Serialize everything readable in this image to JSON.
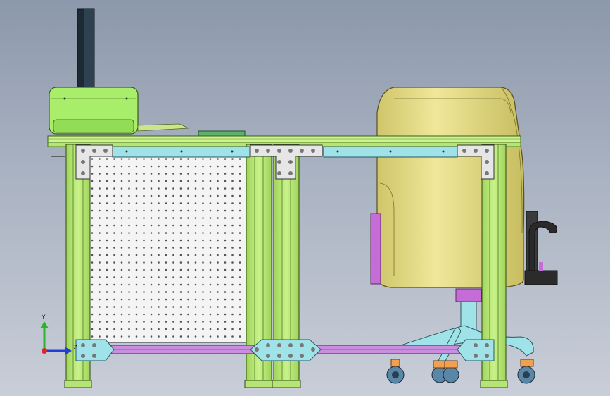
{
  "viewport": {
    "background_top": "#8c98ab",
    "background_bottom": "#c9ced8"
  },
  "model": {
    "frame_color": "#b3e86a",
    "panel_color": "#f2f2f2",
    "bracket_color": "#9fe3e8",
    "rail_color": "#c98ee0",
    "chair_color": "#e9e090",
    "outline_color": "#2a2a2a"
  },
  "triad": {
    "y_label": "Y",
    "z_label": "Z",
    "icons": [
      "y-axis-arrow-icon",
      "x-axis-arrow-icon",
      "origin-icon"
    ]
  }
}
